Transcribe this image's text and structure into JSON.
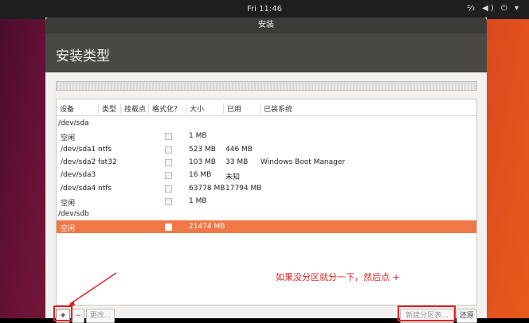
{
  "topbar": {
    "clock": "Fri 11:46",
    "tray": "⅔ ◀) ⏻ ▾"
  },
  "window": {
    "title": "安装"
  },
  "page": {
    "heading": "安装类型"
  },
  "table": {
    "columns": [
      "设备",
      "类型",
      "挂载点",
      "格式化？",
      "大小",
      "已用",
      "已装系统"
    ],
    "rows": [
      {
        "device": "/dev/sda",
        "type": "",
        "mount": "",
        "format": false,
        "size": "",
        "used": "",
        "system": "",
        "kind": "disk"
      },
      {
        "device": "空闲",
        "type": "",
        "mount": "",
        "format": true,
        "size": "1 MB",
        "used": "",
        "system": "",
        "kind": "part"
      },
      {
        "device": "/dev/sda1",
        "type": "ntfs",
        "mount": "",
        "format": true,
        "size": "523 MB",
        "used": "446 MB",
        "system": "",
        "kind": "part"
      },
      {
        "device": "/dev/sda2",
        "type": "fat32",
        "mount": "",
        "format": true,
        "size": "103 MB",
        "used": "33 MB",
        "system": "Windows Boot Manager",
        "kind": "part"
      },
      {
        "device": "/dev/sda3",
        "type": "",
        "mount": "",
        "format": true,
        "size": "16 MB",
        "used": "未知",
        "system": "",
        "kind": "part"
      },
      {
        "device": "/dev/sda4",
        "type": "ntfs",
        "mount": "",
        "format": true,
        "size": "63778 MB",
        "used": "17794 MB",
        "system": "",
        "kind": "part"
      },
      {
        "device": "空闲",
        "type": "",
        "mount": "",
        "format": true,
        "size": "1 MB",
        "used": "",
        "system": "",
        "kind": "part"
      },
      {
        "device": "/dev/sdb",
        "type": "",
        "mount": "",
        "format": false,
        "size": "",
        "used": "",
        "system": "",
        "kind": "disk"
      },
      {
        "device": "空闲",
        "type": "",
        "mount": "",
        "format": true,
        "size": "21474 MB",
        "used": "",
        "system": "",
        "kind": "selected"
      }
    ]
  },
  "annotation": "如果没分区就分一下，然后点 +",
  "buttons": {
    "add": "+",
    "remove": "−",
    "change": "更改...",
    "new_table": "新建分区表...",
    "revert": "还原"
  },
  "colors": {
    "selected_row": "#f07746",
    "annotation": "#e02020"
  }
}
